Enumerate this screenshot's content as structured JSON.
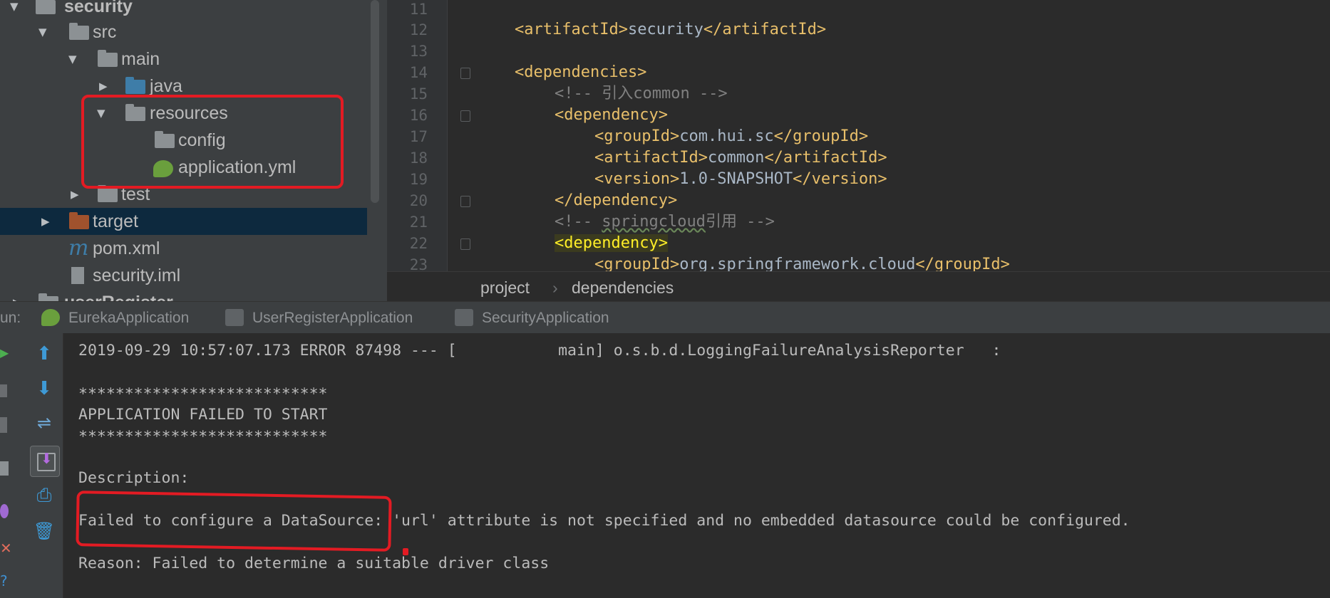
{
  "colors": {
    "tree_bg": "#3c3f41",
    "editor_bg": "#2b2b2b",
    "tag": "#e8bf6a",
    "text": "#a9b7c6",
    "comment": "#808080",
    "highlight_box": "#e31b23",
    "selection": "#0d293e"
  },
  "tree": {
    "items": [
      {
        "label": "security",
        "icon": "module-folder-icon"
      },
      {
        "label": "src",
        "icon": "folder-icon"
      },
      {
        "label": "main",
        "icon": "folder-icon"
      },
      {
        "label": "java",
        "icon": "source-folder-icon"
      },
      {
        "label": "resources",
        "icon": "resources-folder-icon"
      },
      {
        "label": "config",
        "icon": "folder-icon"
      },
      {
        "label": "application.yml",
        "icon": "spring-config-icon"
      },
      {
        "label": "test",
        "icon": "folder-icon"
      },
      {
        "label": "target",
        "icon": "excluded-folder-icon"
      },
      {
        "label": "pom.xml",
        "icon": "maven-icon"
      },
      {
        "label": "security.iml",
        "icon": "iml-file-icon"
      },
      {
        "label": "userRegister",
        "icon": "module-folder-icon"
      }
    ]
  },
  "editor": {
    "line_numbers": [
      "11",
      "12",
      "13",
      "14",
      "15",
      "16",
      "17",
      "18",
      "19",
      "20",
      "21",
      "22",
      "23"
    ],
    "lines": {
      "l12_open": "<artifactId>",
      "l12_text": "security",
      "l12_close": "</artifactId>",
      "l14": "<dependencies>",
      "l15": "<!-- 引入common -->",
      "l16": "<dependency>",
      "l17_open": "<groupId>",
      "l17_text": "com.hui.sc",
      "l17_close": "</groupId>",
      "l18_open": "<artifactId>",
      "l18_text": "common",
      "l18_close": "</artifactId>",
      "l19_open": "<version>",
      "l19_text": "1.0-SNAPSHOT",
      "l19_close": "</version>",
      "l20": "</dependency>",
      "l21_a": "<!-- ",
      "l21_b": "springcloud",
      "l21_c": "引用 -->",
      "l22": "<dependency>",
      "l23_open": "<groupId>",
      "l23_text": "org.springframework.cloud",
      "l23_close": "</groupId>"
    }
  },
  "breadcrumb": {
    "items": [
      "project",
      "dependencies"
    ],
    "separator": "›"
  },
  "run": {
    "label": "un:",
    "tabs": [
      {
        "label": "EurekaApplication",
        "icon": "spring-boot-icon"
      },
      {
        "label": "UserRegisterApplication",
        "icon": "app-icon"
      },
      {
        "label": "SecurityApplication",
        "icon": "app-icon"
      }
    ]
  },
  "console": {
    "lines": [
      "2019-09-29 10:57:07.173 ERROR 87498 --- [           main] o.s.b.d.LoggingFailureAnalysisReporter   :",
      "***************************",
      "APPLICATION FAILED TO START",
      "***************************",
      "Description:",
      "Failed to configure a DataSource: 'url' attribute is not specified and no embedded datasource could be configured.",
      "Reason: Failed to determine a suitable driver class"
    ]
  }
}
